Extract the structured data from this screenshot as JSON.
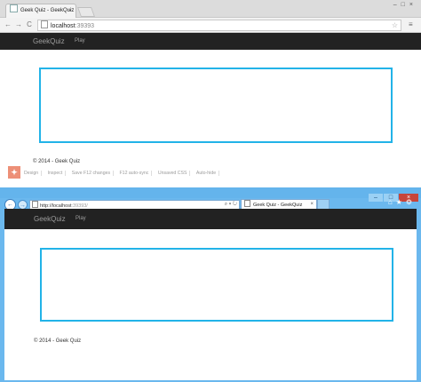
{
  "chrome": {
    "tab_title": "Geek Quiz - GeekQuiz",
    "tab_close": "×",
    "window_controls": "–□×",
    "nav": {
      "back": "←",
      "forward": "→",
      "reload": "C"
    },
    "address": {
      "host": "localhost",
      "port": ":39393"
    },
    "star_icon": "☆",
    "menu_icon": "≡",
    "page": {
      "brand": "GeekQuiz",
      "nav_play": "Play",
      "footer": "© 2014 - Geek Quiz"
    },
    "devtools": {
      "logo": "✦",
      "items": [
        "Design",
        "Inspect",
        "Save F12 changes",
        "F12 auto-sync",
        "Unsaved CSS",
        "Auto-hide"
      ]
    }
  },
  "ie": {
    "window_buttons": {
      "minimize": "–",
      "maximize": "□",
      "close": "×"
    },
    "nav": {
      "back": "←",
      "forward": "→"
    },
    "address": {
      "scheme": "http://",
      "host": "localhost",
      "port": ":39393/",
      "controls": "⌕ ▾ ↻"
    },
    "tab_title": "Geek Quiz - GeekQuiz",
    "tab_close": "×",
    "right_icons": "⌂★⚙",
    "page": {
      "brand": "GeekQuiz",
      "nav_play": "Play",
      "footer": "© 2014 - Geek Quiz"
    }
  },
  "colors": {
    "accent_box": "#22b3e8",
    "navbar": "#222222",
    "ie_frame": "#6bb8ee",
    "close_red": "#c7453a"
  }
}
